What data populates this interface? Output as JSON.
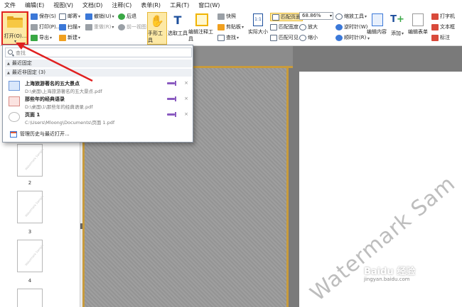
{
  "menu": [
    "文件",
    "编辑(E)",
    "视图(V)",
    "文档(D)",
    "注释(C)",
    "表单(R)",
    "工具(T)",
    "窗口(W)"
  ],
  "ribbon": {
    "open_label": "打开(O)...",
    "save": "保存(S)",
    "print": "打印(P)...",
    "export": "导出",
    "email": "邮寄",
    "scan": "扫描",
    "new": "新建",
    "undo": "撤销(U)",
    "redo": "重做(R)",
    "back": "后退",
    "prev_view": "前一视图",
    "hand_tool": "手形工具",
    "select_tool": "选取工具",
    "edit_annot_tool": "编辑注释工具",
    "snapshot": "快照",
    "clipboard": "剪贴板",
    "find": "查找",
    "actual_size": "实际大小",
    "fit_page": "匹配页面",
    "fit_width": "匹配宽度",
    "fit_visible": "匹配可见",
    "zoom_value": "68.86%",
    "zoom_tool": "缩放工具",
    "zoom_in": "放大",
    "zoom_out": "缩小",
    "rotate_ccw": "逆时针(W)",
    "rotate_cw": "顺时针(R)",
    "edit_content": "编辑内容",
    "add": "添加",
    "edit_form": "编辑表单",
    "typewriter": "打字机",
    "textbox": "文本框",
    "callout": "标注"
  },
  "dropdown": {
    "search_placeholder": "查找",
    "pinned_section": "最近固定",
    "unpinned_section": "最近非固定 (3)",
    "items": [
      {
        "title": "上海旅游著名的五大景点",
        "path": "D:\\桌面\\上海旅游著名的五大景点.pdf"
      },
      {
        "title": "那些年的经典语录",
        "path": "D:\\桌面\\1\\那些年的经典语录.pdf"
      },
      {
        "title": "页面 1",
        "path": "C:\\Users\\Mloong\\Documents\\页面 1.pdf"
      }
    ],
    "manage": "管理历史与最近打开..."
  },
  "thumbnails": [
    {
      "page": "2"
    },
    {
      "page": "3"
    },
    {
      "page": "4"
    }
  ],
  "watermark": "Watermark Sam",
  "baidu": {
    "logo": "Baidu 经验",
    "url": "jingyan.baidu.com"
  }
}
